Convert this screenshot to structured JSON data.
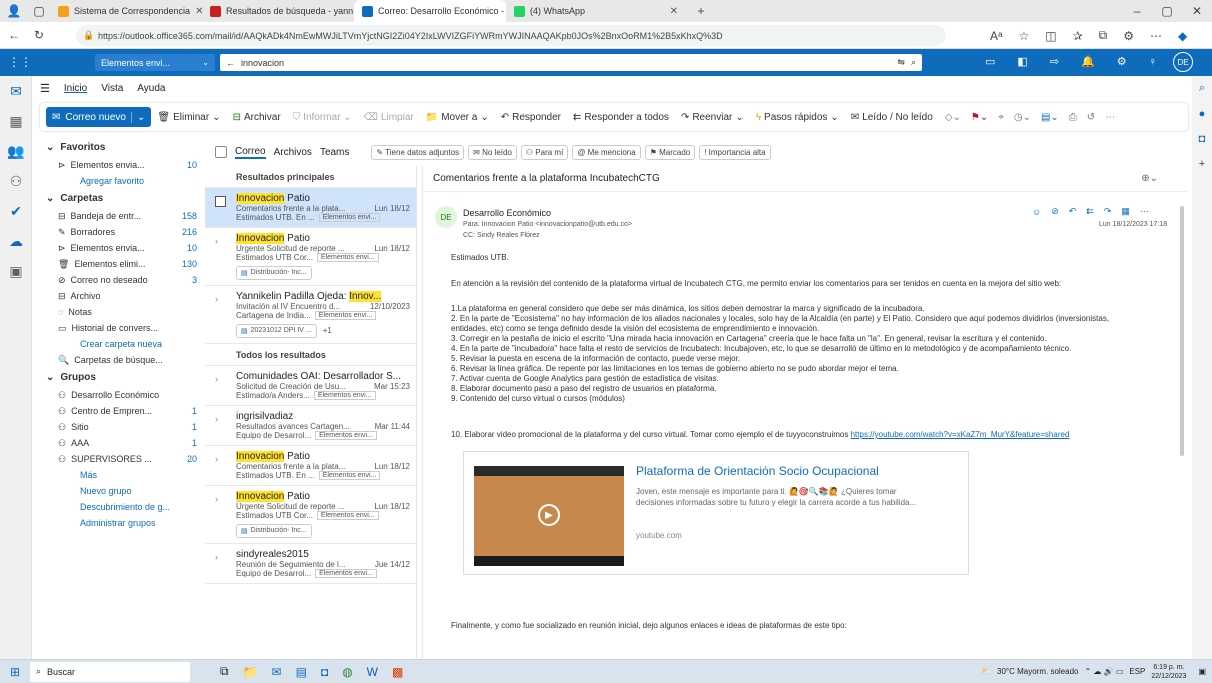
{
  "browser": {
    "tabs": [
      {
        "label": "Sistema de Correspondencia",
        "color": "#f3a31b"
      },
      {
        "label": "Resultados de búsqueda - yann…",
        "color": "#c5221f"
      },
      {
        "label": "Correo: Desarrollo Económico - …",
        "color": "#0f6cbd",
        "active": true
      },
      {
        "label": "(4) WhatsApp",
        "color": "#25d366"
      }
    ],
    "url": "https://outlook.office365.com/mail/id/AAQkADk4NmEwMWJiLTVmYjctNGI2Zi04Y2IxLWVIZGFiYWRmYWJINAAQAKpb0JOs%2BnxOoRM1%2B5xKhxQ%3D"
  },
  "suite": {
    "folder_picker": "Elementos envi...",
    "search_scope": "innovacion",
    "avatar": "DE"
  },
  "nav": {
    "tabs": [
      "Inicio",
      "Vista",
      "Ayuda"
    ]
  },
  "ribbon": {
    "new_mail": "Correo nuevo",
    "delete": "Eliminar",
    "archive": "Archivar",
    "report": "Informar",
    "sweep": "Limpiar",
    "move": "Mover a",
    "reply": "Responder",
    "reply_all": "Responder a todos",
    "forward": "Reenviar",
    "quick_steps": "Pasos rápidos",
    "read_unread": "Leído / No leído"
  },
  "folders": {
    "favoritos": "Favoritos",
    "fav_items": [
      {
        "label": "Elementos envia...",
        "count": "10"
      }
    ],
    "add_fav": "Agregar favorito",
    "carpetas": "Carpetas",
    "items": [
      {
        "icon": "inbox",
        "label": "Bandeja de entr...",
        "count": "158"
      },
      {
        "icon": "draft",
        "label": "Borradores",
        "count": "216"
      },
      {
        "icon": "sent",
        "label": "Elementos envia...",
        "count": "10"
      },
      {
        "icon": "trash",
        "label": "Elementos elimi...",
        "count": "130"
      },
      {
        "icon": "junk",
        "label": "Correo no deseado",
        "count": "3"
      },
      {
        "icon": "archive",
        "label": "Archivo",
        "count": ""
      },
      {
        "icon": "notes",
        "label": "Notas",
        "count": ""
      },
      {
        "icon": "history",
        "label": "Historial de convers...",
        "count": ""
      }
    ],
    "new_folder": "Crear carpeta nueva",
    "search_folders": "Carpetas de búsque...",
    "grupos": "Grupos",
    "groups": [
      {
        "label": "Desarrollo Económico",
        "count": ""
      },
      {
        "label": "Centro de Empren...",
        "count": "1"
      },
      {
        "label": "Sitio",
        "count": "1"
      },
      {
        "label": "AAA",
        "count": "1"
      },
      {
        "label": "SUPERVISORES ...",
        "count": "20"
      }
    ],
    "more": "Más",
    "new_group": "Nuevo grupo",
    "discover": "Descubrimiento de g...",
    "manage": "Administrar grupos"
  },
  "list": {
    "tabs": [
      "Correo",
      "Archivos",
      "Teams"
    ],
    "filters": [
      "Tiene datos adjuntos",
      "No leído",
      "Para mí",
      "Me menciona",
      "Marcado",
      "Importancia alta"
    ],
    "top_header": "Resultados principales",
    "all_header": "Todos los resultados",
    "top": [
      {
        "from_hl": "Innovacion",
        "from": " Patio",
        "subject": "Comentarios frente a la plata...",
        "date": "Lun 18/12",
        "preview": "Estimados UTB. En ...",
        "tag": "Elementos envi...",
        "selected": true
      },
      {
        "from_hl": "Innovacion",
        "from": " Patio",
        "subject": "Urgente Solicitud de reporte ...",
        "date": "Lun 18/12",
        "preview": "Estimados UTB Cor...",
        "tag": "Elementos envi...",
        "att": "Distribución- Inc..."
      },
      {
        "from": "Yannikelin Padilla Ojeda: ",
        "from_hl": "Innov...",
        "subject": "Invitación al IV Encuentro d...",
        "date": "12/10/2023",
        "preview": "Cartagena de India...",
        "tag": "Elementos envi...",
        "att": "20231012 DPI IV ...",
        "att_extra": "+1"
      }
    ],
    "all": [
      {
        "from": "Comunidades OAI: Desarrollador S...",
        "subject": "Solicitud de Creación de Usu...",
        "date": "Mar 15:23",
        "preview": "Estimado/a Anders...",
        "tag": "Elementos envi..."
      },
      {
        "from": "ingrisilvadiaz",
        "subject": "Resultados avances Cartagen...",
        "date": "Mar 11:44",
        "preview": "Equipo de Desarrol...",
        "tag": "Elementos envi..."
      },
      {
        "from_hl": "Innovacion",
        "from": " Patio",
        "subject": "Comentarios frente a la plata...",
        "date": "Lun 18/12",
        "preview": "Estimados UTB. En ...",
        "tag": "Elementos envi..."
      },
      {
        "from_hl": "Innovacion",
        "from": " Patio",
        "subject": "Urgente Solicitud de reporte ...",
        "date": "Lun 18/12",
        "preview": "Estimados UTB Cor...",
        "tag": "Elementos envi...",
        "att": "Distribución- Inc..."
      },
      {
        "from": "sindyreales2015",
        "subject": "Reunión de Seguimiento de l...",
        "date": "Jue 14/12",
        "preview": "Equipo de Desarrol...",
        "tag": "Elementos envi..."
      }
    ]
  },
  "reading": {
    "subject": "Comentarios frente a la plataforma IncubatechCTG",
    "avatar": "DE",
    "sender": "Desarrollo Económico",
    "to": "Para:  Innovacion Patio <innovacionpatio@utb.edu.co>",
    "cc": "CC:  Sindy Reales Flórez",
    "date": "Lun 18/12/2023 17:18",
    "greeting": "Estimados UTB.",
    "intro": "En atención a la revisión del contenido de la plataforma virtual de Incubatech CTG, me permito enviar los comentarios para ser tenidos en cuenta en la mejora del sitio web:",
    "points": [
      "1.La plataforma en general considero que debe ser más dinámica, los sitios deben demostrar la marca y significado de la incubadora.",
      "2. En la parte de \"Ecosistema\" no hay información de los aliados nacionales y locales, solo hay de la Alcaldía (en parte) y El Patio. Considero que aquí podemos dividirlos (inversionistas,",
      "entidades, etc) como se tenga definido desde la visión del ecosistema de emprendimiento e innovación.",
      "3. Corregir en la pestaña de inicio el escrito \"Una mirada hacia innovación en Cartagena\" creería que le hace falta un \"la\". En general, revisar la escritura y el contenido.",
      "4. En la parte de \"incubadora\" hace falta el resto de servicios de Incubatech: Incubajoven, etc, lo que se desarrolló de último en lo metodológico y de acompañamiento técnico.",
      "5. Revisar la puesta en escena de la información de contacto, puede verse mejor.",
      "6. Revisar la línea gráfica. De repente por las limitaciones en los temas de gobierno abierto no se pudo abordar mejor el tema.",
      "7. Activar cuenta de Google Analytics para gestión de estadística de visitas.",
      "8. Elaborar documento paso a paso del registro de usuarios en plataforma.",
      "9. Contenido del curso virtual o cursos (módulos)"
    ],
    "point10": "10. Elaborar video promocional de la plataforma y del curso virtual.  Tomar como ejemplo el de tuyyoconstruimos ",
    "link": "https://youtube.com/watch?v=xKaZ7m_MurY&feature=shared",
    "card_title": "Plataforma de Orientación Socio Ocupacional",
    "card_desc": "Joven, este mensaje es importante para ti. 🙋🎯🔍📚🙋 ¿Quieres tomar decisiones informadas sobre tu futuro y elegir la carrera acorde a tus habilida...",
    "card_site": "youtube.com",
    "closing": "Finalmente, y como fue socializado en reunión inicial, dejo algunos enlaces e ideas de plataformas de este tipo:"
  },
  "taskbar": {
    "search": "Buscar",
    "weather": "30°C  Mayorm. soleado",
    "lang": "ESP",
    "time": "6:19 p. m.",
    "date": "22/12/2023"
  }
}
